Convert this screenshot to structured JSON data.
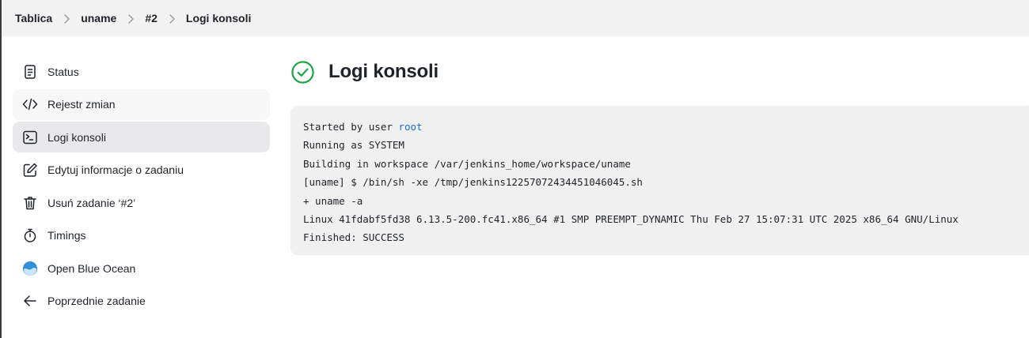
{
  "breadcrumb": {
    "items": [
      "Tablica",
      "uname",
      "#2",
      "Logi konsoli"
    ]
  },
  "sidebar": {
    "items": [
      {
        "label": "Status",
        "icon": "document-icon"
      },
      {
        "label": "Rejestr zmian",
        "icon": "code-icon"
      },
      {
        "label": "Logi konsoli",
        "icon": "terminal-icon",
        "active": true
      },
      {
        "label": "Edytuj informacje o zadaniu",
        "icon": "edit-icon"
      },
      {
        "label": "Usuń zadanie ‘#2’",
        "icon": "trash-icon"
      },
      {
        "label": "Timings",
        "icon": "stopwatch-icon"
      },
      {
        "label": "Open Blue Ocean",
        "icon": "blue-ocean-icon"
      },
      {
        "label": "Poprzednie zadanie",
        "icon": "arrow-left-icon"
      }
    ]
  },
  "main": {
    "title": "Logi konsoli",
    "status_icon": "check-circle-icon",
    "status_color": "#1ea446"
  },
  "console": {
    "line1_prefix": "Started by user ",
    "line1_user": "root",
    "lines": [
      "Running as SYSTEM",
      "Building in workspace /var/jenkins_home/workspace/uname",
      "[uname] $ /bin/sh -xe /tmp/jenkins12257072434451046045.sh",
      "+ uname -a",
      "Linux 41fdabf5fd38 6.13.5-200.fc41.x86_64 #1 SMP PREEMPT_DYNAMIC Thu Feb 27 15:07:31 UTC 2025 x86_64 GNU/Linux",
      "Finished: SUCCESS"
    ]
  },
  "colors": {
    "link": "#1a6fc9",
    "breadcrumb_bg": "#f2f2f3",
    "console_bg": "#f0f0f1"
  }
}
